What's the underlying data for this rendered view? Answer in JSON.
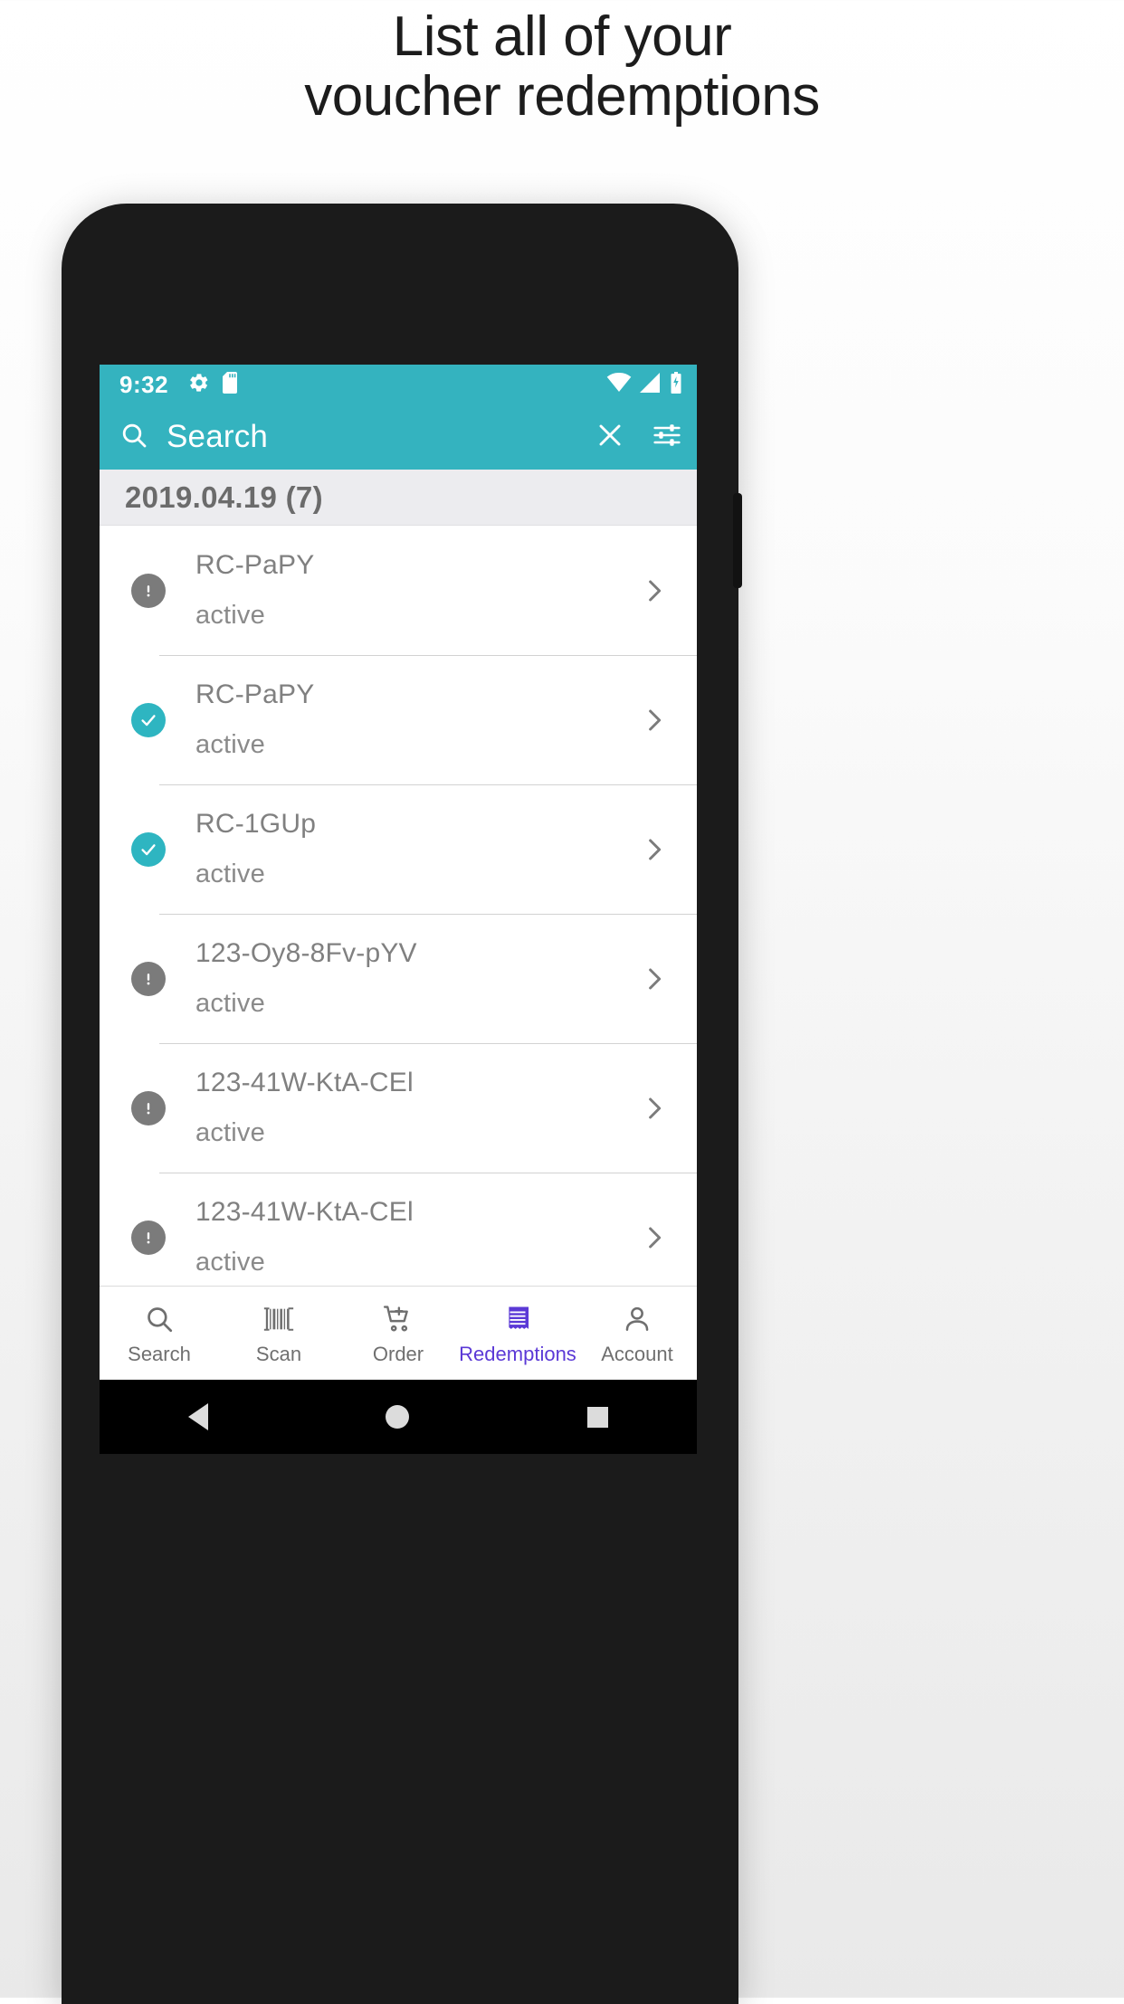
{
  "promo": {
    "line1": "List all of your",
    "line2": "voucher redemptions"
  },
  "colors": {
    "accent_teal": "#34b3bf",
    "badge_ok": "#2eb5c1",
    "badge_warn": "#7b7b7b",
    "active_nav": "#5b39d6",
    "date_header_bg": "#ececef"
  },
  "statusbar": {
    "time": "9:32",
    "icons_left": [
      "gear-icon",
      "sd-card-icon"
    ],
    "icons_right": [
      "wifi-icon",
      "cellular-signal-icon",
      "battery-icon"
    ]
  },
  "searchbar": {
    "icon": "search-icon",
    "placeholder": "Search",
    "value": "",
    "clear_icon": "close-icon",
    "filter_icon": "filter-sliders-icon"
  },
  "date_header": {
    "label": "2019.04.19 (7)"
  },
  "list": {
    "rows": [
      {
        "icon": "warning-icon",
        "status_kind": "warn",
        "code": "RC-PaPY",
        "status": "active",
        "chevron": "chevron-right-icon"
      },
      {
        "icon": "check-icon",
        "status_kind": "ok",
        "code": "RC-PaPY",
        "status": "active",
        "chevron": "chevron-right-icon"
      },
      {
        "icon": "check-icon",
        "status_kind": "ok",
        "code": "RC-1GUp",
        "status": "active",
        "chevron": "chevron-right-icon"
      },
      {
        "icon": "warning-icon",
        "status_kind": "warn",
        "code": "123-Oy8-8Fv-pYV",
        "status": "active",
        "chevron": "chevron-right-icon"
      },
      {
        "icon": "warning-icon",
        "status_kind": "warn",
        "code": "123-41W-KtA-CEl",
        "status": "active",
        "chevron": "chevron-right-icon"
      },
      {
        "icon": "warning-icon",
        "status_kind": "warn",
        "code": "123-41W-KtA-CEl",
        "status": "active",
        "chevron": "chevron-right-icon"
      }
    ]
  },
  "bottomnav": {
    "items": [
      {
        "label": "Search",
        "icon": "search-icon",
        "active": false
      },
      {
        "label": "Scan",
        "icon": "barcode-icon",
        "active": false
      },
      {
        "label": "Order",
        "icon": "cart-add-icon",
        "active": false
      },
      {
        "label": "Redemptions",
        "icon": "receipt-icon",
        "active": true
      },
      {
        "label": "Account",
        "icon": "person-icon",
        "active": false
      }
    ]
  },
  "androidnav": {
    "back": "back-triangle-icon",
    "home": "home-circle-icon",
    "recents": "recents-square-icon"
  }
}
